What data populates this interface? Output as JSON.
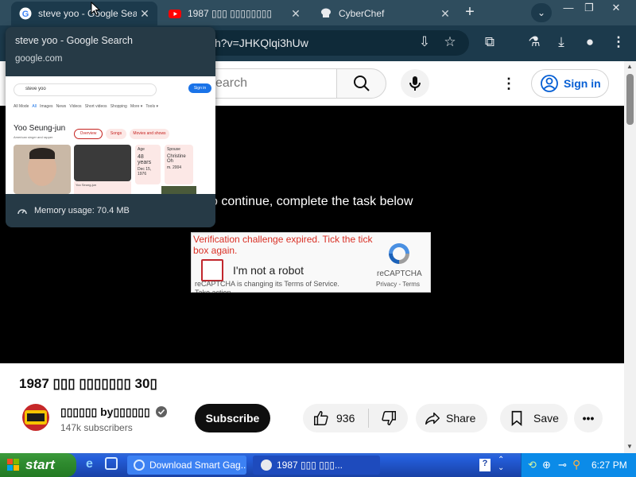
{
  "browser": {
    "tabs": [
      {
        "label": "steve yoo - Google Search",
        "icon": "google-icon",
        "active": true
      },
      {
        "label": "1987 ▯▯▯ ▯▯▯▯▯▯▯▯",
        "icon": "youtube-icon",
        "active": false
      },
      {
        "label": "CyberChef",
        "icon": "cyberchef-icon",
        "active": false
      }
    ],
    "new_tab": "+",
    "url_fragment": "h?v=JHKQlqi3hUw"
  },
  "hovercard": {
    "title": "steve yoo - Google Search",
    "domain": "google.com",
    "memory": "Memory usage: 70.4 MB",
    "preview": {
      "query": "steve yoo",
      "signin": "Sign in",
      "filters": [
        "All Mode",
        "All",
        "Images",
        "News",
        "Videos",
        "Short videos",
        "Shopping",
        "More ▾",
        "Tools ▾"
      ],
      "name": "Yoo Seung-jun",
      "subtitle": "American singer and rapper",
      "chips": [
        "Overview",
        "Songs",
        "Movies and shows"
      ],
      "age_label": "Age",
      "age_value": "48 years",
      "age_date": "Dec 15, 1976",
      "spouse_label": "Spouse",
      "spouse_value": "Christine Oh",
      "spouse_note": "m. 2004",
      "news_caption": "Yoo Seung-jun"
    }
  },
  "youtube": {
    "search_placeholder": "earch",
    "signin": "Sign in",
    "player": {
      "continue_text": "o continue, complete the task below",
      "captcha": {
        "error": "Verification challenge expired. Tick the tick box again.",
        "checkbox_label": "I'm not a robot",
        "brand": "reCAPTCHA",
        "links": "Privacy - Terms",
        "notice": "reCAPTCHA is changing its Terms of Service.",
        "notice2": "Take action."
      }
    },
    "video_title": "1987 ▯▯▯ ▯▯▯▯▯▯▯ 30▯",
    "channel_name": "▯▯▯▯▯▯ by▯▯▯▯▯▯",
    "subscribers": "147k subscribers",
    "subscribe": "Subscribe",
    "likes": "936",
    "share": "Share",
    "save": "Save"
  },
  "taskbar": {
    "start": "start",
    "tasks": [
      "Download Smart Gag...",
      "1987 ▯▯▯ ▯▯▯..."
    ],
    "clock": "6:27 PM"
  },
  "colors": {
    "tabstrip": "#2f4d5e",
    "toolbar": "#1c3a4c",
    "youtube_blue": "#065fd4",
    "captcha_error": "#d93025"
  }
}
